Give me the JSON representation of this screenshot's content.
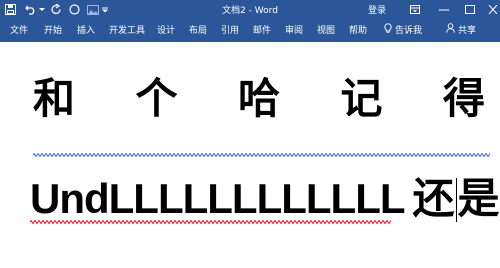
{
  "app": {
    "title": "文档2  -  Word",
    "login": "登录"
  },
  "ribbon": {
    "tabs": [
      "文件",
      "开始",
      "插入",
      "开发工具",
      "设计",
      "布局",
      "引用",
      "邮件",
      "审阅",
      "视图",
      "帮助"
    ],
    "tell_me": "告诉我",
    "share": "共享"
  },
  "document": {
    "line1": [
      "和",
      "个",
      "哈",
      "记",
      "得"
    ],
    "line2_latin": "UndLLLLLLLLLLLL",
    "line2_cjk_before_cursor": "还",
    "line2_cjk_after_cursor": "是"
  },
  "colors": {
    "ribbon": "#2b579a",
    "spell_error": "#e81123",
    "grammar": "#3c6ad7"
  }
}
